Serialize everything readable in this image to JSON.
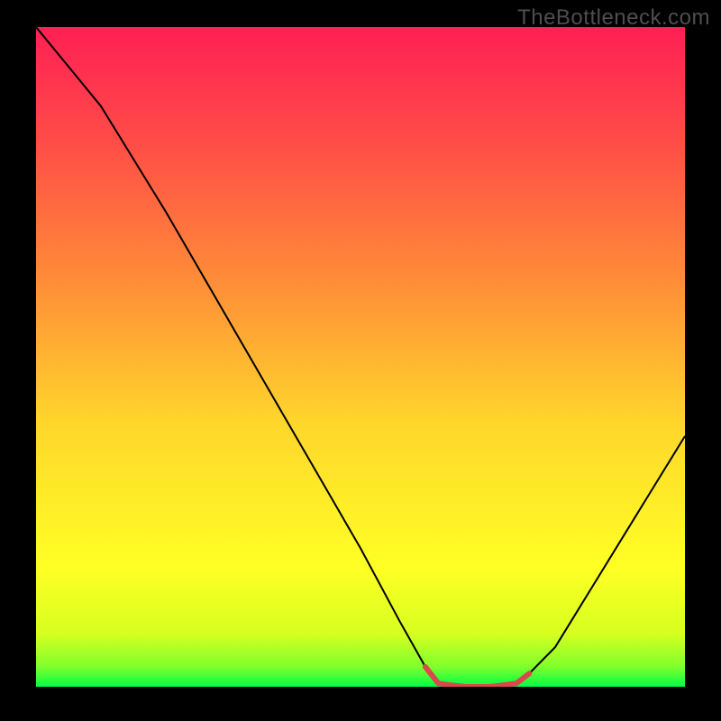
{
  "watermark": "TheBottleneck.com",
  "chart_data": {
    "type": "line",
    "title": "",
    "xlabel": "",
    "ylabel": "",
    "xlim": [
      0,
      100
    ],
    "ylim": [
      0,
      100
    ],
    "gradient_stops": [
      {
        "offset": 0.0,
        "color": "#00ff47"
      },
      {
        "offset": 0.03,
        "color": "#7fff2c"
      },
      {
        "offset": 0.08,
        "color": "#d6ff20"
      },
      {
        "offset": 0.18,
        "color": "#ffff24"
      },
      {
        "offset": 0.4,
        "color": "#ffd62c"
      },
      {
        "offset": 0.62,
        "color": "#ff8b38"
      },
      {
        "offset": 0.82,
        "color": "#ff4e47"
      },
      {
        "offset": 1.0,
        "color": "#ff1f54"
      }
    ],
    "series": [
      {
        "name": "curve",
        "color": "#000000",
        "width": 2,
        "points": [
          {
            "x": 0,
            "y": 100
          },
          {
            "x": 5,
            "y": 94
          },
          {
            "x": 10,
            "y": 88
          },
          {
            "x": 20,
            "y": 72
          },
          {
            "x": 30,
            "y": 55
          },
          {
            "x": 40,
            "y": 38
          },
          {
            "x": 50,
            "y": 21
          },
          {
            "x": 56,
            "y": 10
          },
          {
            "x": 60,
            "y": 3
          },
          {
            "x": 62,
            "y": 0.5
          },
          {
            "x": 66,
            "y": 0
          },
          {
            "x": 70,
            "y": 0
          },
          {
            "x": 74,
            "y": 0.5
          },
          {
            "x": 76,
            "y": 2
          },
          {
            "x": 80,
            "y": 6
          },
          {
            "x": 85,
            "y": 14
          },
          {
            "x": 90,
            "y": 22
          },
          {
            "x": 95,
            "y": 30
          },
          {
            "x": 100,
            "y": 38
          }
        ]
      }
    ],
    "highlight": {
      "color": "#d8494b",
      "width": 6,
      "points": [
        {
          "x": 60,
          "y": 3
        },
        {
          "x": 62,
          "y": 0.5
        },
        {
          "x": 66,
          "y": 0
        },
        {
          "x": 70,
          "y": 0
        },
        {
          "x": 74,
          "y": 0.5
        },
        {
          "x": 76,
          "y": 2
        }
      ],
      "endpoints": [
        {
          "x": 60,
          "y": 3
        },
        {
          "x": 76,
          "y": 2
        }
      ],
      "endpoint_radius": 3
    }
  }
}
